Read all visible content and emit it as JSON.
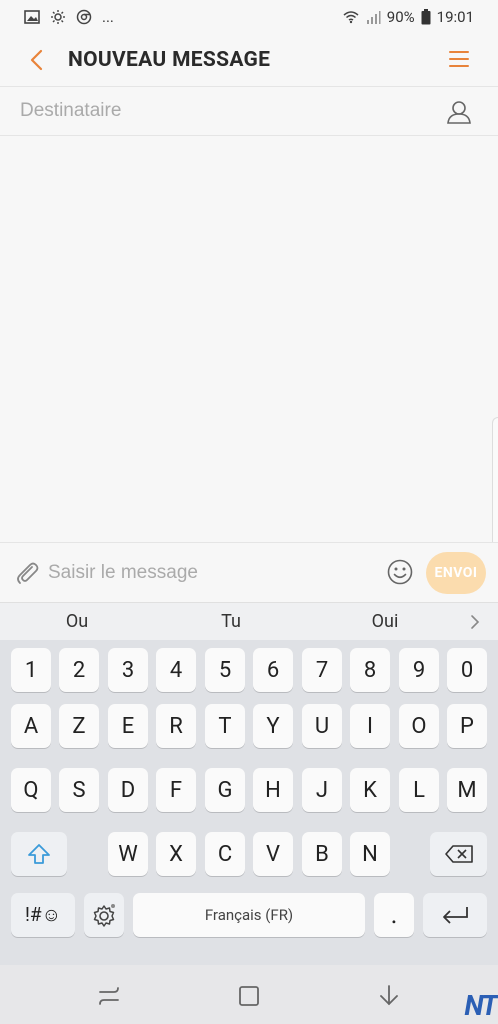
{
  "status_bar": {
    "icons_left": [
      "image-icon",
      "sun-settings-icon",
      "chrome-icon"
    ],
    "overflow": "...",
    "battery": "90%",
    "time": "19:01"
  },
  "app_bar": {
    "title": "NOUVEAU MESSAGE",
    "accent_color": "#e8833a"
  },
  "recipient": {
    "placeholder": "Destinataire"
  },
  "compose": {
    "placeholder": "Saisir le message",
    "send_label": "ENVOI"
  },
  "suggestions": [
    "Ou",
    "Tu",
    "Oui"
  ],
  "keyboard": {
    "row_numbers": [
      "1",
      "2",
      "3",
      "4",
      "5",
      "6",
      "7",
      "8",
      "9",
      "0"
    ],
    "row1": [
      "A",
      "Z",
      "E",
      "R",
      "T",
      "Y",
      "U",
      "I",
      "O",
      "P"
    ],
    "row2": [
      "Q",
      "S",
      "D",
      "F",
      "G",
      "H",
      "J",
      "K",
      "L",
      "M"
    ],
    "row3": [
      "W",
      "X",
      "C",
      "V",
      "B",
      "N"
    ],
    "symbols_label": "!#☺",
    "space_label": "Français (FR)",
    "period_label": "."
  },
  "watermark": "NT"
}
